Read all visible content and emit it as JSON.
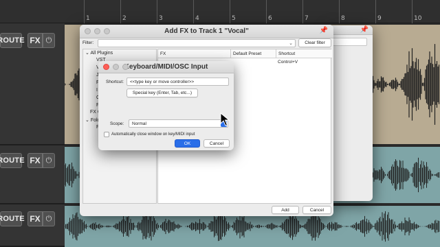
{
  "ruler": {
    "marks": [
      "1",
      "2",
      "3",
      "4",
      "5",
      "6",
      "7",
      "8",
      "9",
      "10"
    ]
  },
  "tracks": [
    {
      "route_label": "ROUTE",
      "fx_label": "FX",
      "power_icon": "power-icon"
    },
    {
      "route_label": "ROUTE",
      "fx_label": "FX",
      "power_icon": "power-icon"
    },
    {
      "route_label": "ROUTE",
      "fx_label": "FX",
      "power_icon": "power-icon"
    }
  ],
  "add_fx_window": {
    "title": "Add FX to Track 1 \"Vocal\"",
    "filter_label": "Filter:",
    "filter_value": "",
    "clear_filter_label": "Clear filter",
    "tree": {
      "all_plugins": "All Plugins",
      "items": [
        "VST",
        "V",
        "J",
        "F",
        "I",
        "C",
        "F"
      ],
      "fx_chains": "FX C",
      "folders": "Fold",
      "folder_child": "F"
    },
    "columns": [
      "FX",
      "Default Preset",
      "Shortcut"
    ],
    "rows": [
      {
        "fx": "",
        "preset": "",
        "shortcut": "Control+V"
      }
    ],
    "add_label": "Add",
    "cancel_label": "Cancel"
  },
  "kbd_dialog": {
    "title": "Keyboard/MIDI/OSC Input",
    "shortcut_label": "Shortcut:",
    "shortcut_value": "<<type key or move controller>>",
    "special_key_label": "Special key (Enter, Tab, etc...)",
    "scope_label": "Scope:",
    "scope_value": "Normal",
    "autoclose_label": "Automatically close window on key/MIDI input",
    "autoclose_checked": false,
    "ok_label": "OK",
    "cancel_label": "Cancel"
  },
  "colors": {
    "primary_button": "#2a6ee8",
    "close_light": "#fe5f57",
    "waveform_item_tan": "#b8ab92",
    "waveform_item_teal": "#7fa5a7",
    "waveform_stroke": "#222222"
  }
}
